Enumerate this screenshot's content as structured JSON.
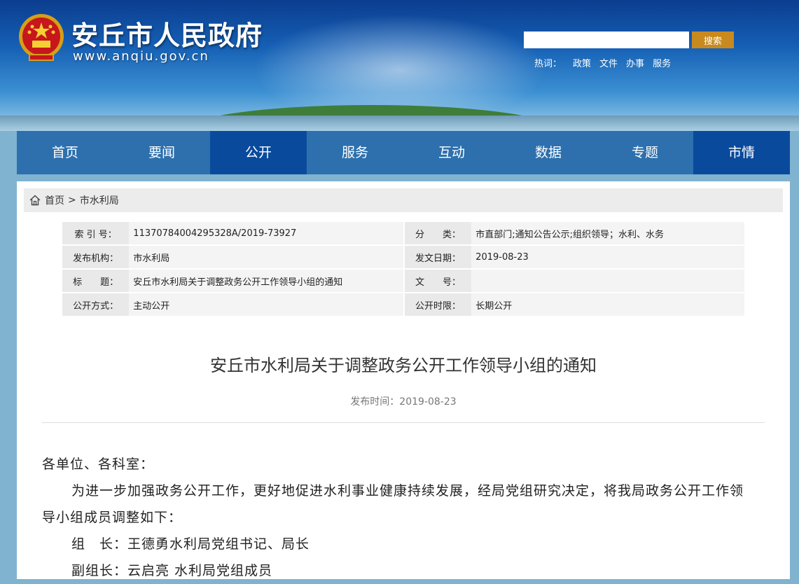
{
  "header": {
    "site_title": "安丘市人民政府",
    "site_domain": "www.anqiu.gov.cn",
    "search_placeholder": "",
    "search_button": "搜索",
    "hotwords_label": "热词：",
    "hotwords": [
      "政策",
      "文件",
      "办事",
      "服务"
    ]
  },
  "nav": {
    "items": [
      "首页",
      "要闻",
      "公开",
      "服务",
      "互动",
      "数据",
      "专题",
      "市情"
    ],
    "active": "公开"
  },
  "breadcrumb": {
    "home": "首页",
    "separator": ">",
    "current": "市水利局"
  },
  "meta": {
    "index_label": "索 引 号：",
    "index_value": "11370784004295328A/2019-73927",
    "category_label": "分　　类：",
    "category_value": "市直部门;通知公告公示;组织领导；水利、水务",
    "publisher_label": "发布机构：",
    "publisher_value": "市水利局",
    "date_label": "发文日期：",
    "date_value": "2019-08-23",
    "title_label": "标　　题：",
    "title_value": "安丘市水利局关于调整政务公开工作领导小组的通知",
    "docno_label": "文　　号：",
    "docno_value": "",
    "method_label": "公开方式：",
    "method_value": "主动公开",
    "period_label": "公开时限：",
    "period_value": "长期公开"
  },
  "article": {
    "title": "安丘市水利局关于调整政务公开工作领导小组的通知",
    "pubtime": "发布时间：2019-08-23",
    "salutation": "各单位、各科室：",
    "para1": "为进一步加强政务公开工作，更好地促进水利事业健康持续发展，经局党组研究决定，将我局政务公开工作领导小组成员调整如下：",
    "line_leader": "组　长：王德勇水利局党组书记、局长",
    "line_deputy": "副组长：云启亮 水利局党组成员"
  },
  "colors": {
    "nav_bg": "#2d70ad",
    "nav_active": "#0a4a9c",
    "search_button": "#c88a1e"
  }
}
